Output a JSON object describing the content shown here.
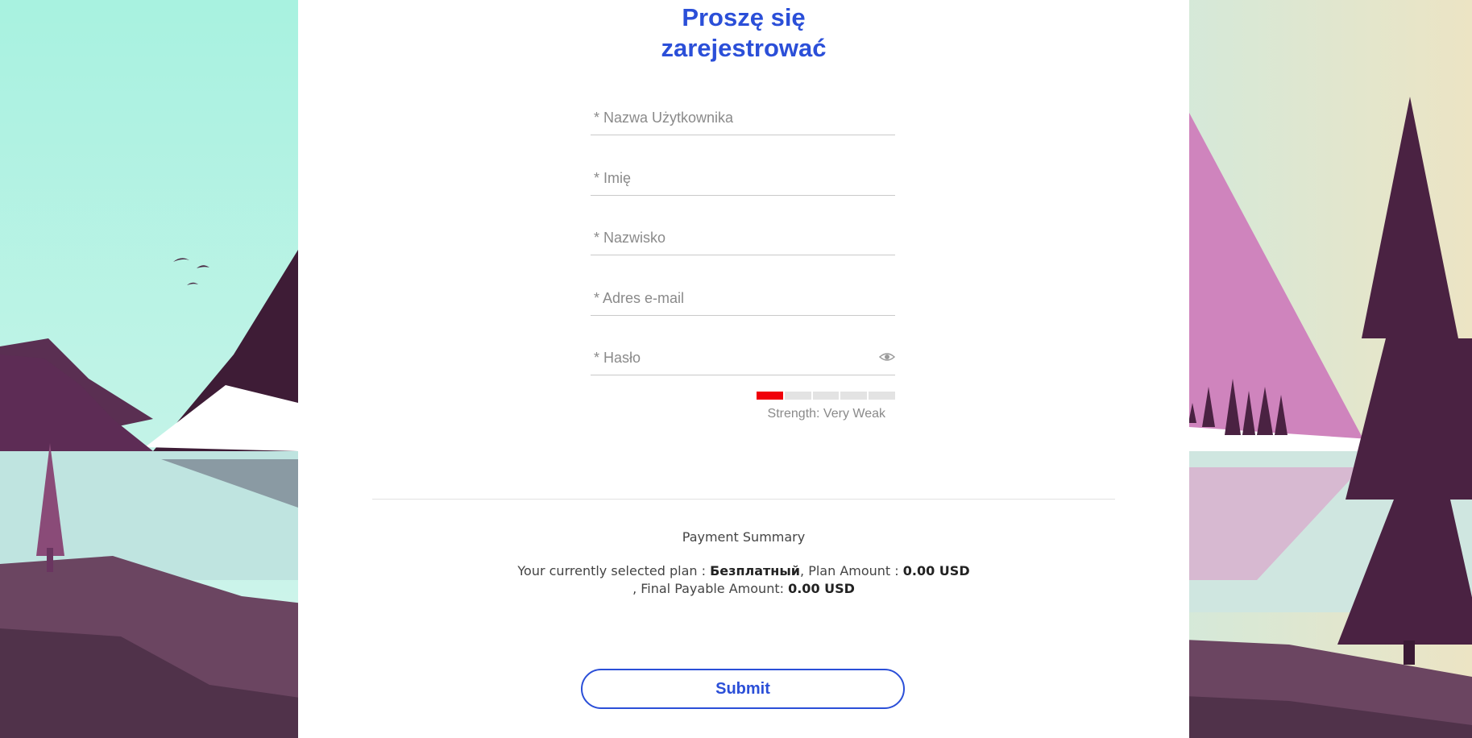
{
  "form": {
    "title_line1": "Proszę się",
    "title_line2": "zarejestrować",
    "fields": [
      {
        "name": "username",
        "placeholder": "* Nazwa Użytkownika",
        "value": ""
      },
      {
        "name": "first-name",
        "placeholder": "* Imię",
        "value": ""
      },
      {
        "name": "last-name",
        "placeholder": "* Nazwisko",
        "value": ""
      },
      {
        "name": "email",
        "placeholder": "* Adres e-mail",
        "value": ""
      },
      {
        "name": "password",
        "placeholder": "* Hasło",
        "value": ""
      }
    ],
    "password_toggle_icon": "eye-icon",
    "strength": {
      "label": "Strength: Very Weak",
      "level": 1,
      "segments": 5,
      "active_color": "#f0000a"
    }
  },
  "payment": {
    "title": "Payment Summary",
    "plan_prefix": "Your currently selected plan : ",
    "plan_name": "Безплатный",
    "plan_amount_prefix": ", Plan Amount : ",
    "plan_amount": "0.00 USD",
    "final_prefix": ", Final Payable Amount: ",
    "final_amount": "0.00 USD"
  },
  "submit_label": "Submit",
  "colors": {
    "accent": "#2b4fd8",
    "weak": "#f0000a"
  }
}
